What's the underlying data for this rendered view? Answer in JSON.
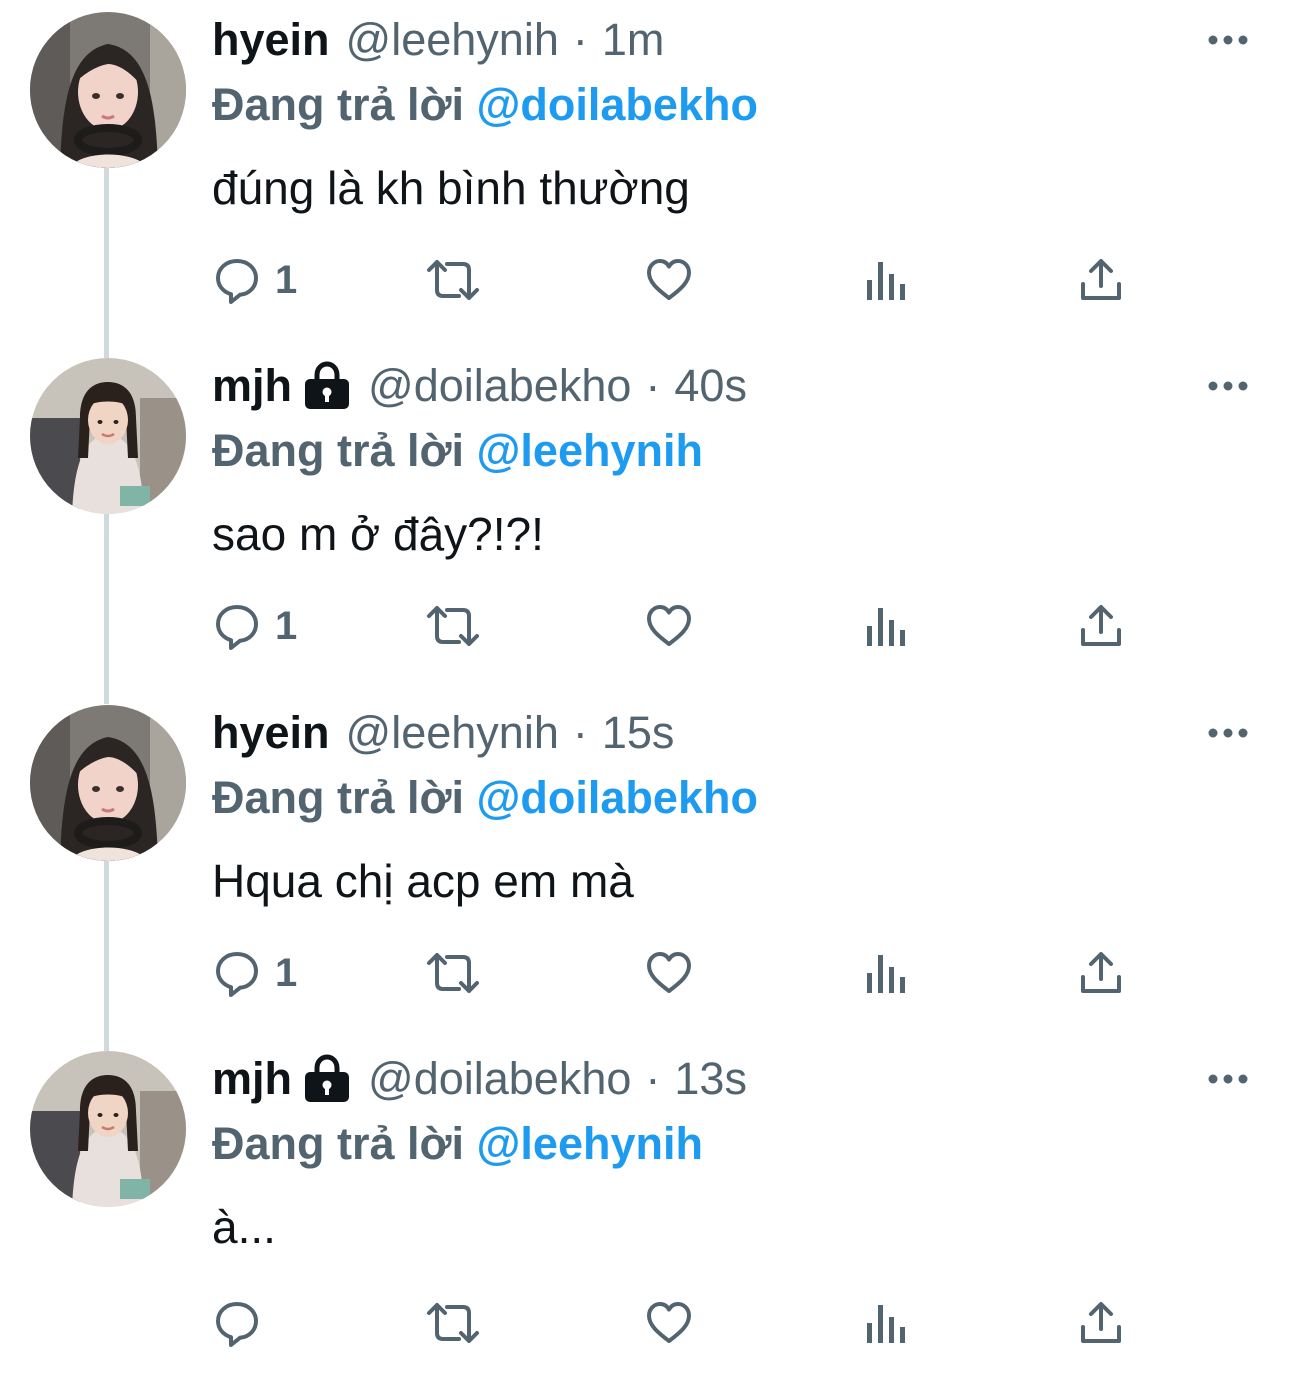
{
  "labels": {
    "replying_to": "Đang trả lời"
  },
  "colors": {
    "text": "#0f1419",
    "secondary": "#536471",
    "mention": "#1d9bf0",
    "thread_line": "#cfd9de"
  },
  "tweets": [
    {
      "name": "hyein",
      "protected": false,
      "handle": "@leehynih",
      "dot": "·",
      "time": "1m",
      "reply_to": "@doilabekho",
      "text": "đúng là kh bình thường",
      "reply_count": "1",
      "avatar": "hyein-avatar"
    },
    {
      "name": "mjh",
      "protected": true,
      "handle": "@doilabekho",
      "dot": "·",
      "time": "40s",
      "reply_to": "@leehynih",
      "text": "sao m ở đây?!?!",
      "reply_count": "1",
      "avatar": "mjh-avatar"
    },
    {
      "name": "hyein",
      "protected": false,
      "handle": "@leehynih",
      "dot": "·",
      "time": "15s",
      "reply_to": "@doilabekho",
      "text": "Hqua chị acp em mà",
      "reply_count": "1",
      "avatar": "hyein-avatar"
    },
    {
      "name": "mjh",
      "protected": true,
      "handle": "@doilabekho",
      "dot": "·",
      "time": "13s",
      "reply_to": "@leehynih",
      "text": "à...",
      "reply_count": "",
      "avatar": "mjh-avatar"
    }
  ],
  "icons": {
    "reply": "reply-icon",
    "retweet": "retweet-icon",
    "like": "like-icon",
    "views": "views-icon",
    "share": "share-icon",
    "more": "more-icon",
    "lock": "lock-icon"
  }
}
